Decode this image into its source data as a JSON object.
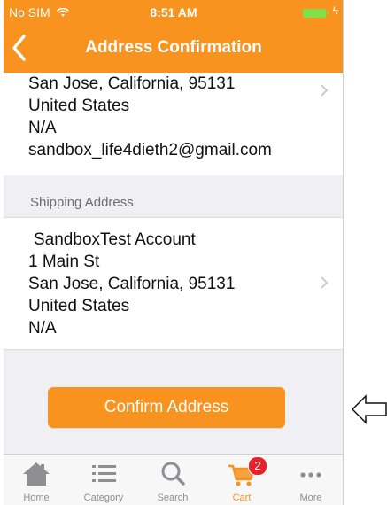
{
  "status_bar": {
    "carrier": "No SIM",
    "time": "8:51 AM"
  },
  "nav": {
    "title": "Address Confirmation"
  },
  "billing": {
    "lines": [
      "San Jose, California, 95131",
      "United States",
      "N/A",
      "sandbox_life4dieth2@gmail.com"
    ]
  },
  "shipping": {
    "header": "Shipping Address",
    "lines": [
      "SandboxTest Account",
      "1 Main St",
      "San Jose, California, 95131",
      "United States",
      "N/A"
    ]
  },
  "confirm": {
    "label": "Confirm Address"
  },
  "tabs": [
    {
      "label": "Home",
      "icon": "home-icon"
    },
    {
      "label": "Category",
      "icon": "list-icon"
    },
    {
      "label": "Search",
      "icon": "search-icon"
    },
    {
      "label": "Cart",
      "icon": "cart-icon",
      "badge": "2"
    },
    {
      "label": "More",
      "icon": "more-icon"
    }
  ],
  "colors": {
    "accent": "#f7931e",
    "background": "#efeff4",
    "badge": "#e8202a"
  }
}
